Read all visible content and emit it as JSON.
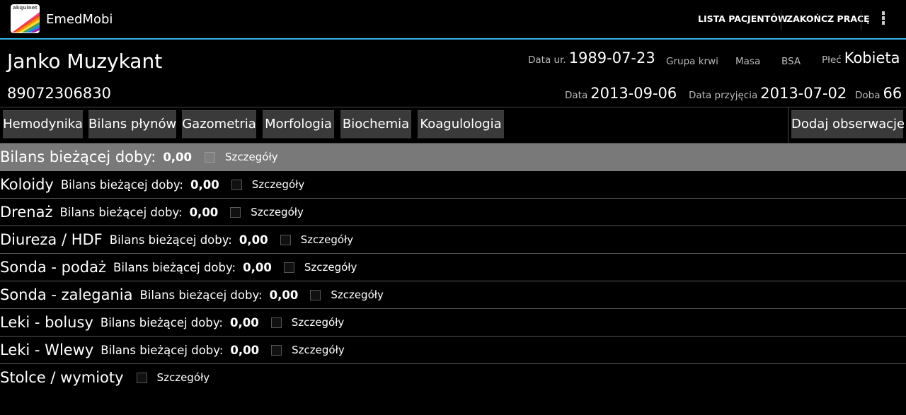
{
  "app": {
    "title": "EmedMobi",
    "logo_text": "akquinet",
    "menu": {
      "patient_list": "LISTA PACJENTÓW",
      "end_work": "ZAKOŃCZ PRACĘ"
    },
    "accent_color": "#33b5e5"
  },
  "patient": {
    "name": "Janko Muzykant",
    "id": "89072306830",
    "birth_label": "Data ur.",
    "birth_value": "1989-07-23",
    "blood_label": "Grupa krwi",
    "mass_label": "Masa",
    "bsa_label": "BSA",
    "sex_label": "Płeć",
    "sex_value": "Kobieta",
    "date_label": "Data",
    "date_value": "2013-09-06",
    "admission_label": "Data przyjęcia",
    "admission_value": "2013-07-02",
    "day_label": "Doba",
    "day_value": "66"
  },
  "tabs": [
    "Hemodynika",
    "Bilans płynów",
    "Gazometria",
    "Morfologia",
    "Biochemia",
    "Koagulologia"
  ],
  "add_observation": "Dodaj obserwacje",
  "rows": [
    {
      "title": "Bilans bieżącej doby:",
      "value": "0,00",
      "details": "Szczegóły"
    },
    {
      "title": "Koloidy",
      "balance_label": "Bilans bieżącej doby:",
      "value": "0,00",
      "details": "Szczegóły"
    },
    {
      "title": "Drenaż",
      "balance_label": "Bilans bieżącej doby:",
      "value": "0,00",
      "details": "Szczegóły"
    },
    {
      "title": "Diureza / HDF",
      "balance_label": "Bilans bieżącej doby:",
      "value": "0,00",
      "details": "Szczegóły"
    },
    {
      "title": "Sonda - podaż",
      "balance_label": "Bilans bieżącej doby:",
      "value": "0,00",
      "details": "Szczegóły"
    },
    {
      "title": "Sonda - zalegania",
      "balance_label": "Bilans bieżącej doby:",
      "value": "0,00",
      "details": "Szczegóły"
    },
    {
      "title": "Leki - bolusy",
      "balance_label": "Bilans bieżącej doby:",
      "value": "0,00",
      "details": "Szczegóły"
    },
    {
      "title": "Leki - Wlewy",
      "balance_label": "Bilans bieżącej doby:",
      "value": "0,00",
      "details": "Szczegóły"
    },
    {
      "title": "Stolce / wymioty",
      "details": "Szczegóły"
    }
  ]
}
